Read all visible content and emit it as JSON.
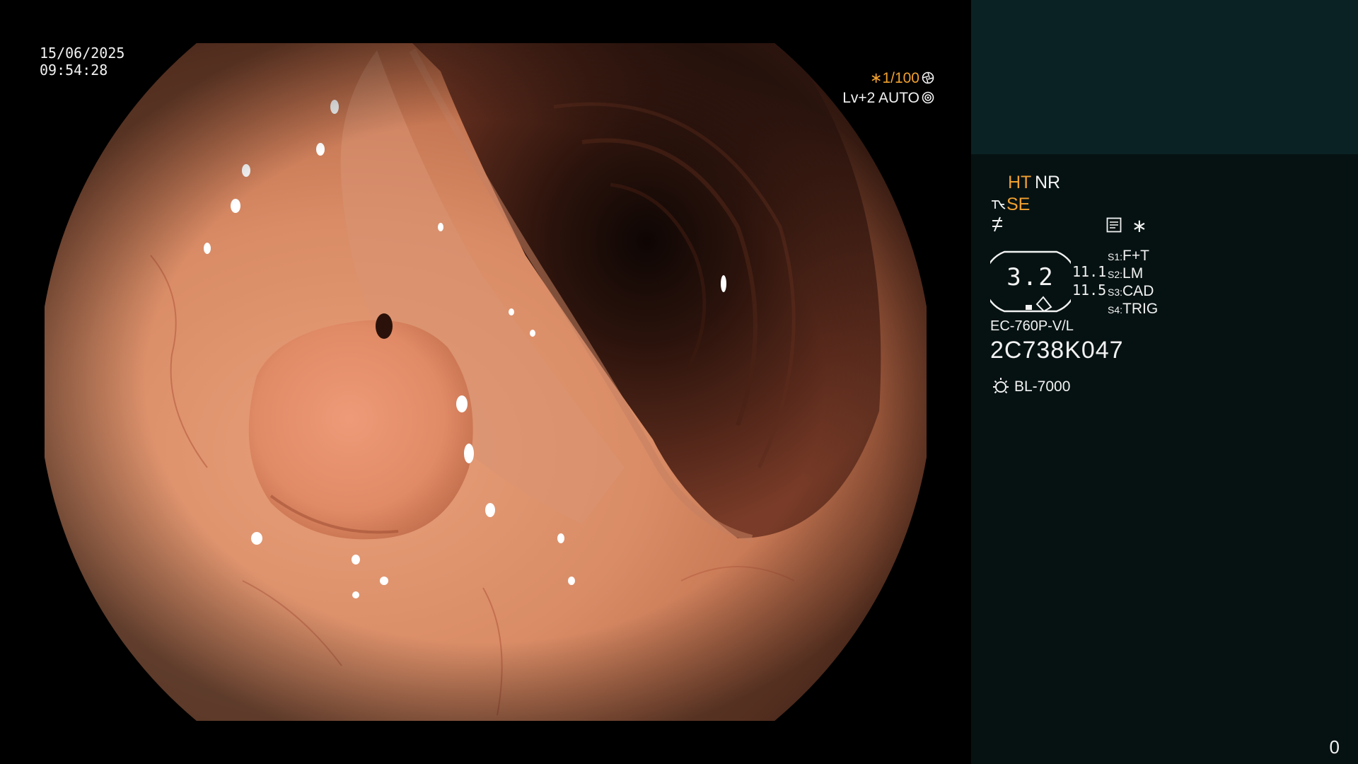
{
  "overlay": {
    "date": "15/06/2025",
    "time": "09:54:28",
    "shutter": "∗1/100",
    "iris": "Lv+2 AUTO"
  },
  "panel": {
    "mode_ht": "HT",
    "mode_nr": "NR",
    "se_label": "SE",
    "star": "∗",
    "dial_value": "3.2",
    "dial_num_1": "11.1",
    "dial_num_2": "11.5",
    "switches": [
      {
        "key": "S1:",
        "value": "F+T"
      },
      {
        "key": "S2:",
        "value": "LM"
      },
      {
        "key": "S3:",
        "value": "CAD"
      },
      {
        "key": "S4:",
        "value": "TRIG"
      }
    ],
    "scope_model": "EC-760P-V/L",
    "scope_serial": "2C738K047",
    "light_source": "BL-7000",
    "counter": "0"
  },
  "icons": {
    "shutter_icon": "aperture-icon",
    "iris_icon": "iris-icon",
    "se_icon": "structure-enhance-icon",
    "freeze_icon": "freeze-icon",
    "memo_icon": "memo-icon",
    "light_icon": "light-source-icon"
  },
  "colors": {
    "accent_orange": "#f0a030",
    "panel_bg": "#061212",
    "patient_box_bg": "#0b2224",
    "text": "#f2f2f2"
  }
}
